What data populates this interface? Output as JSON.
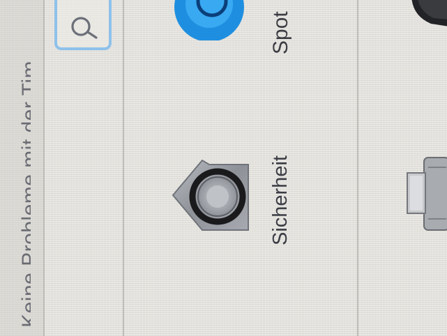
{
  "sidebar": {
    "status_text": "Keine Probleme mit der Tim"
  },
  "search": {
    "icon": "magnifier-icon"
  },
  "panes": {
    "spotlight": {
      "label": "Spot",
      "icon": "spotlight-icon",
      "color": "#1e8fe0"
    },
    "security": {
      "label": "Sicherheit",
      "icon": "security-house-icon"
    }
  },
  "colors": {
    "accent": "#8ec1ea",
    "background": "#e7e5e0"
  }
}
